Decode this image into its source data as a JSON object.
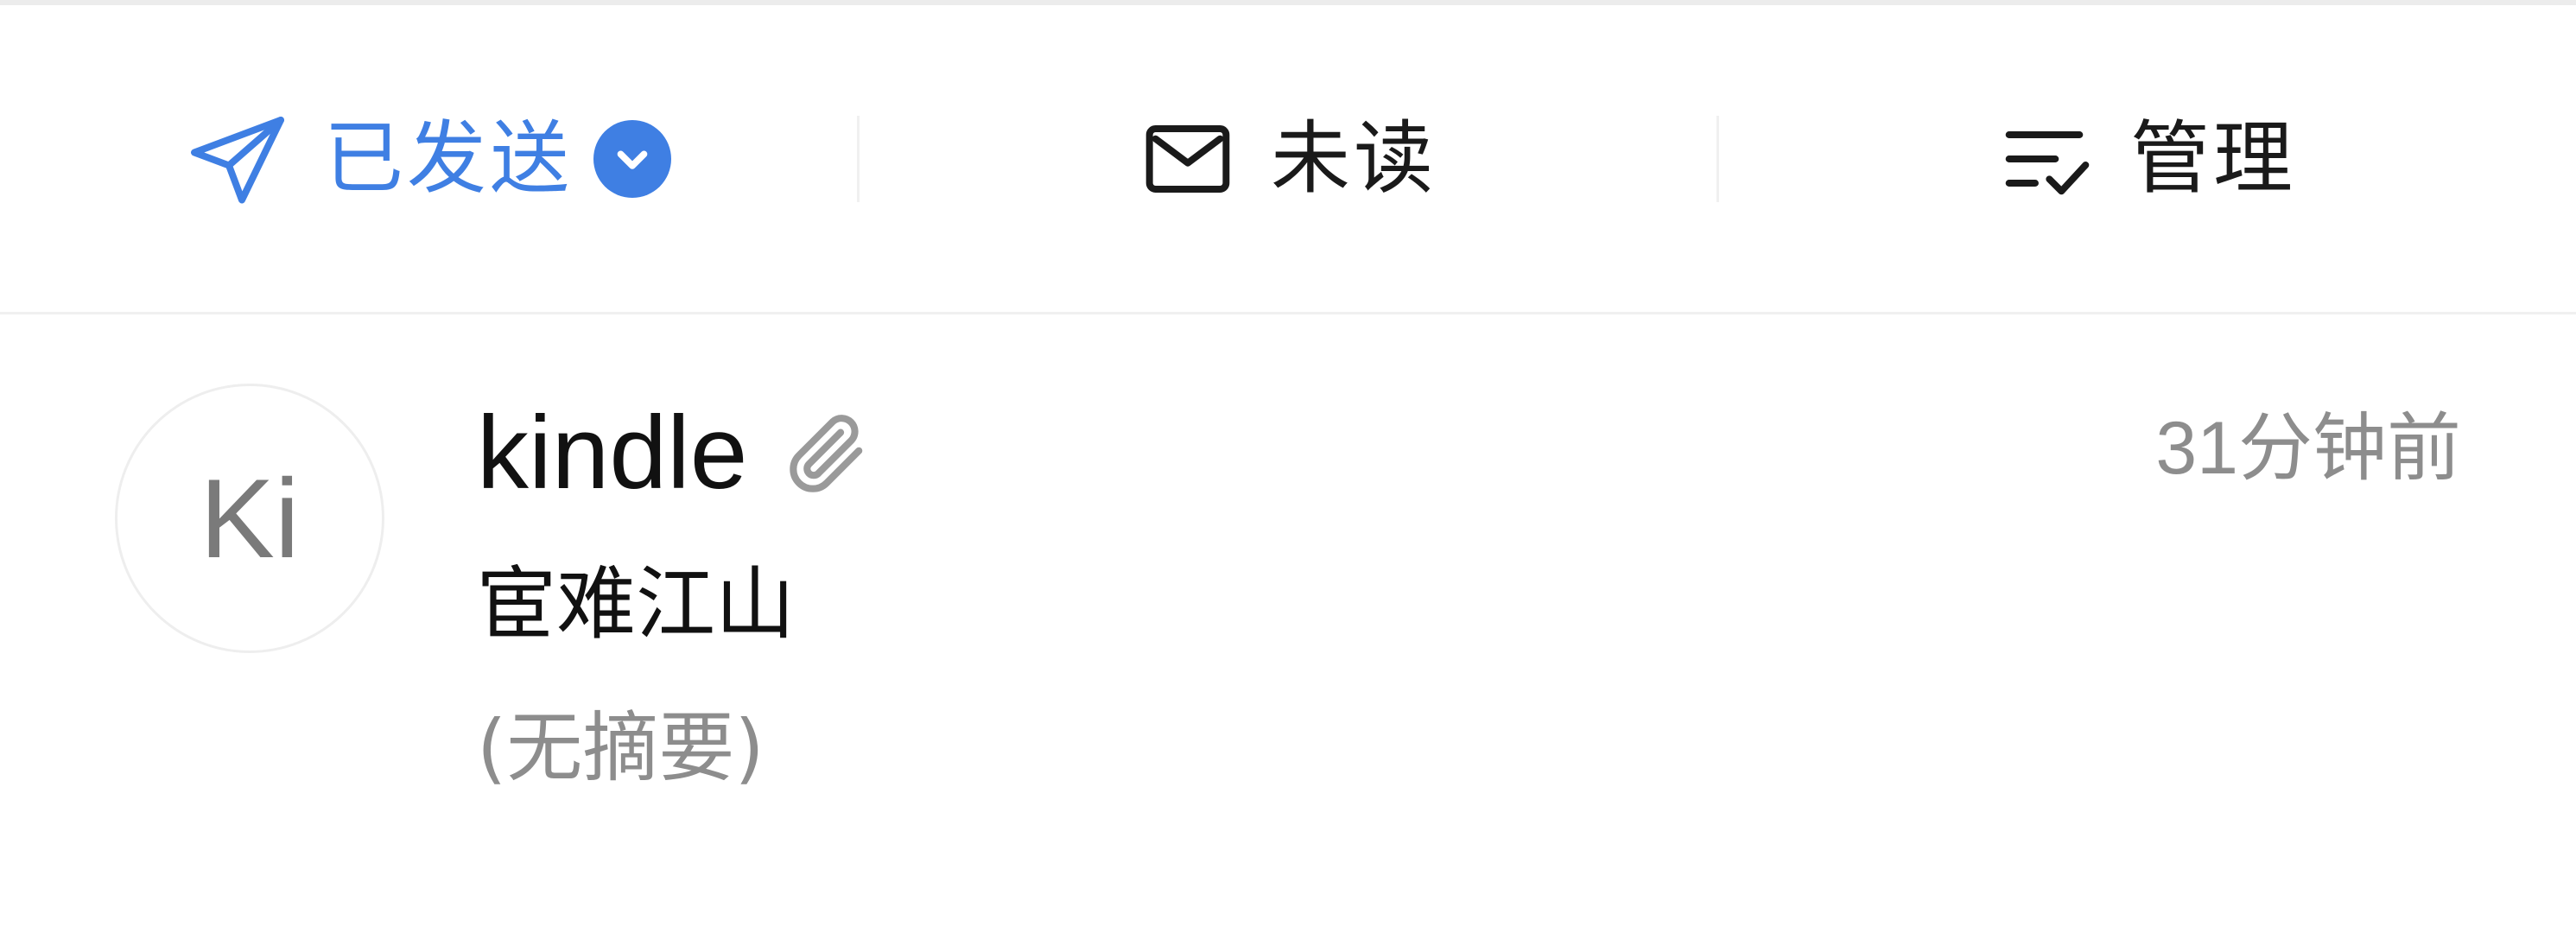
{
  "toolbar": {
    "sent": {
      "label": "已发送",
      "icon": "send-icon",
      "accent_color": "#3f7fe3"
    },
    "unread": {
      "label": "未读",
      "icon": "envelope-icon"
    },
    "manage": {
      "label": "管理",
      "icon": "list-check-icon"
    }
  },
  "mail": {
    "avatar_text": "Ki",
    "sender": "kindle",
    "has_attachment_icon": "paperclip-icon",
    "time": "31分钟前",
    "subject": "宦难江山",
    "summary": "(无摘要)"
  }
}
